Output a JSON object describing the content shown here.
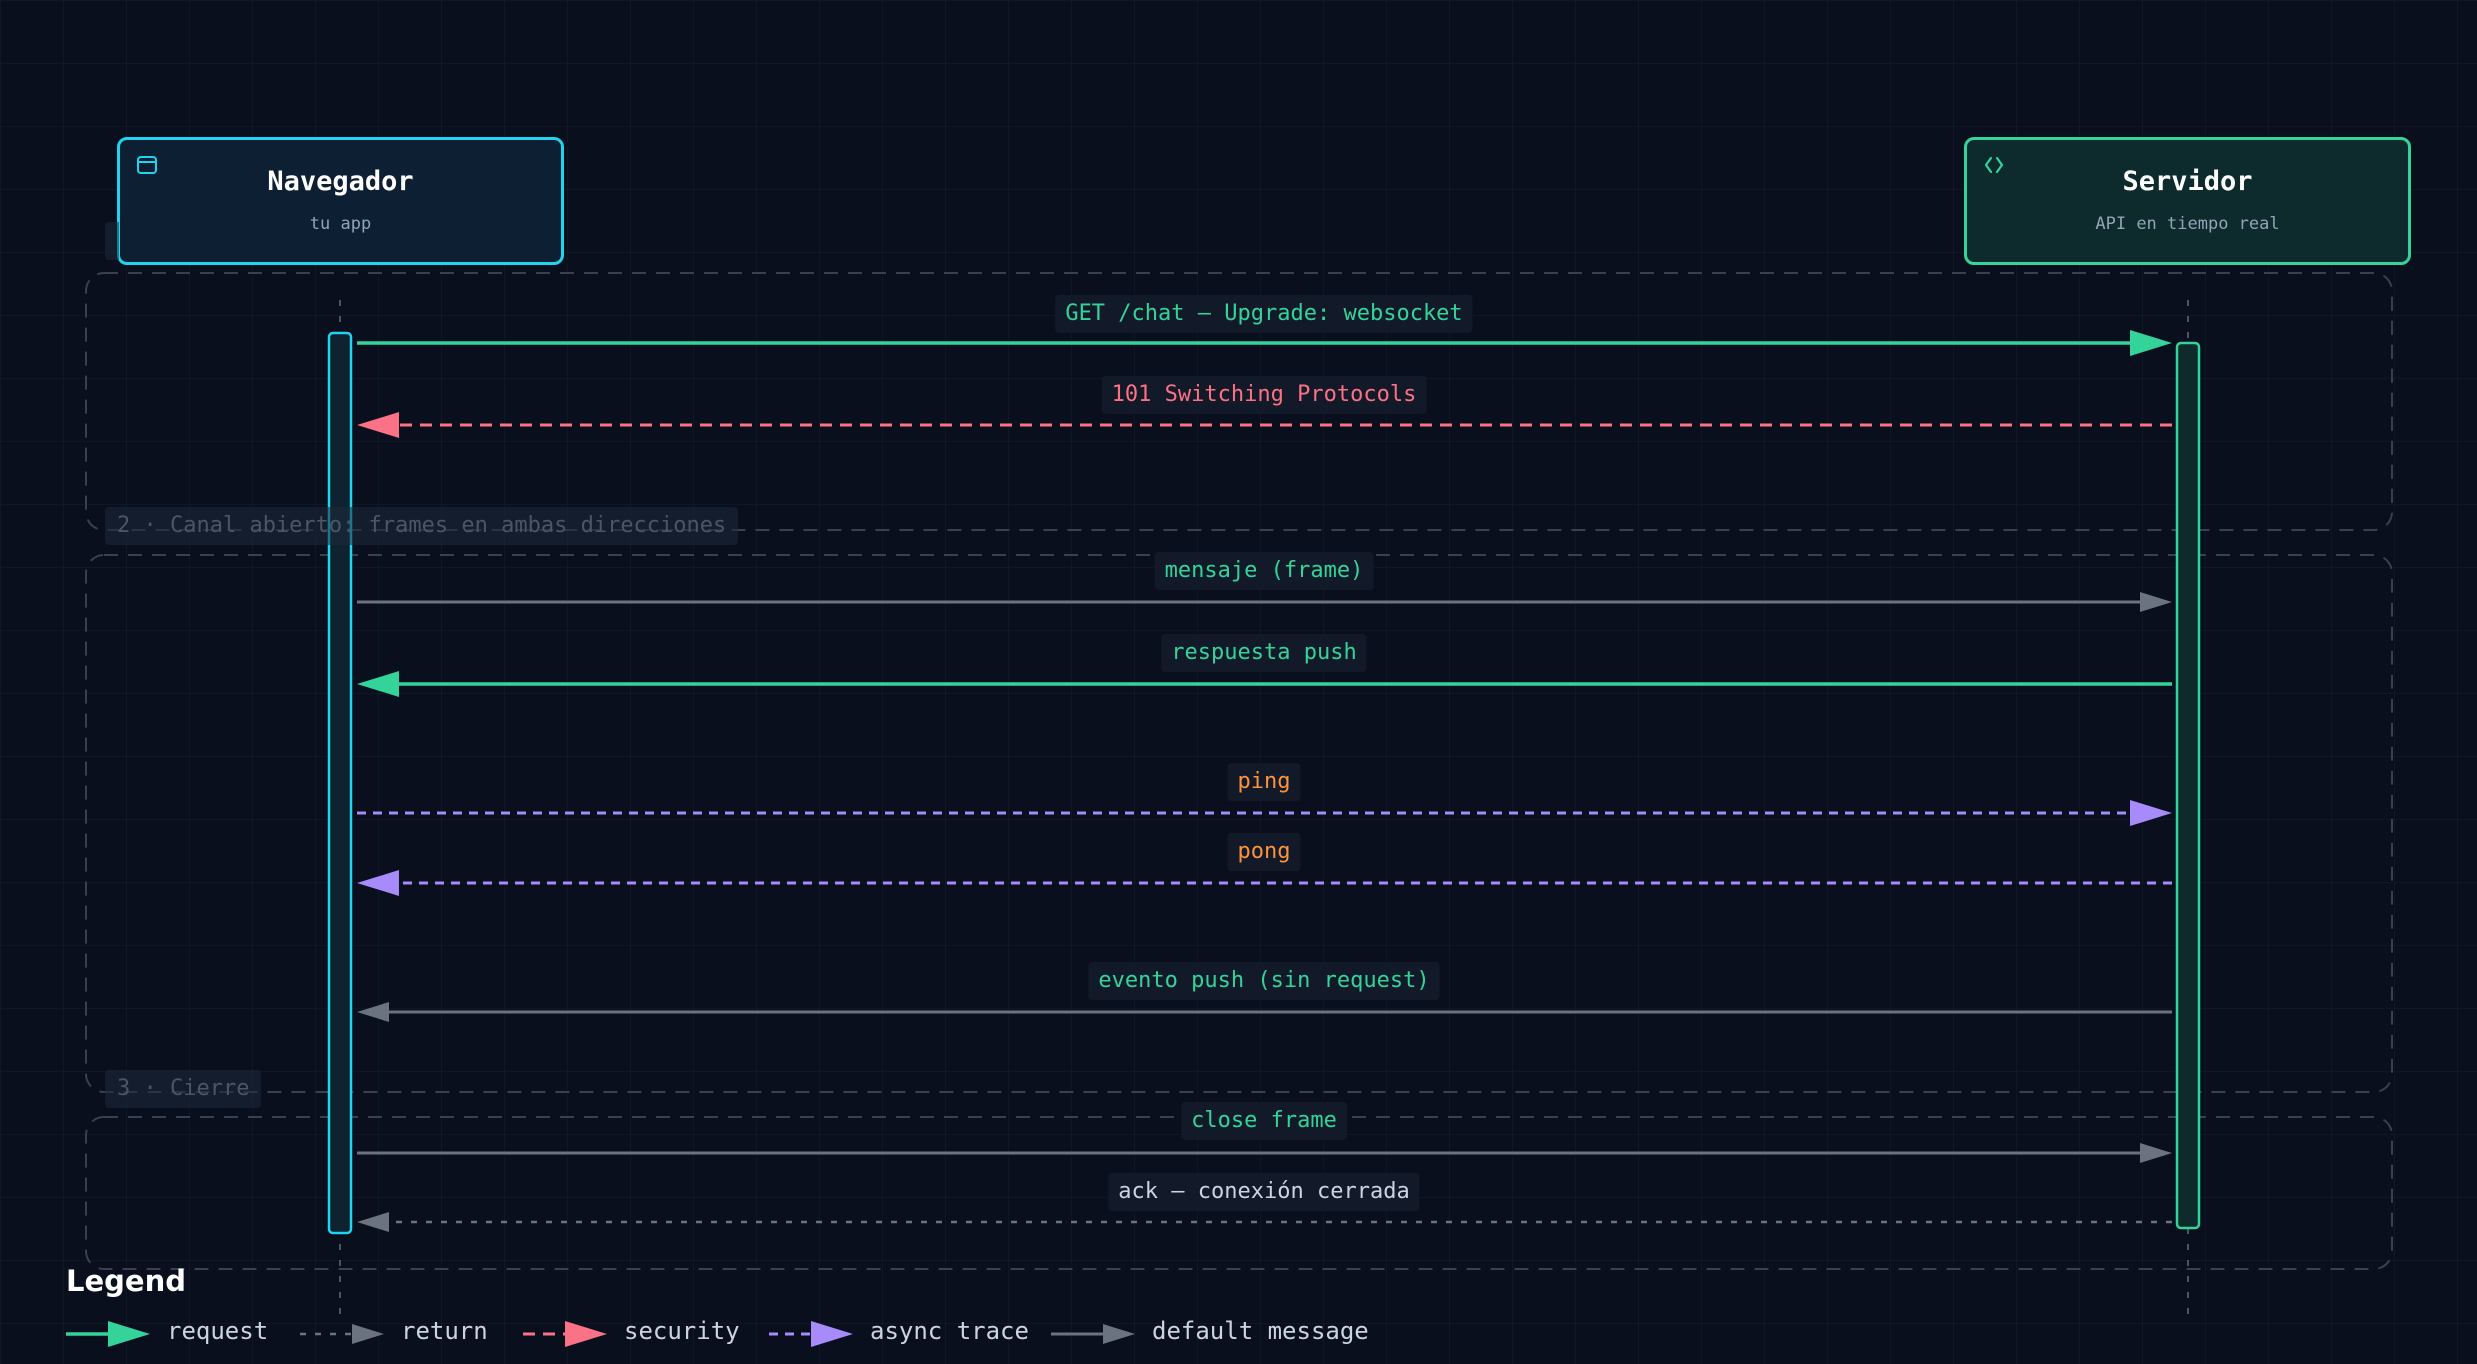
{
  "actors": [
    {
      "name": "Navegador",
      "subtitle": "tu app",
      "icon": "browser-window-icon",
      "color": "#22d3ee"
    },
    {
      "name": "Servidor",
      "subtitle": "API en tiempo real",
      "icon": "code-brackets-icon",
      "color": "#34d399"
    }
  ],
  "frames": [
    {
      "label": ""
    },
    {
      "label": "2 · Canal abierto: frames en ambas direcciones"
    },
    {
      "label": "3 · Cierre"
    }
  ],
  "messages": [
    {
      "label": "GET /chat — Upgrade: websocket",
      "from": "Navegador",
      "to": "Servidor",
      "type": "request",
      "label_color": "#34d399"
    },
    {
      "label": "101 Switching Protocols",
      "from": "Servidor",
      "to": "Navegador",
      "type": "security",
      "label_color": "#fb7185"
    },
    {
      "label": "mensaje (frame)",
      "from": "Navegador",
      "to": "Servidor",
      "type": "default",
      "label_color": "#34d399"
    },
    {
      "label": "respuesta push",
      "from": "Servidor",
      "to": "Navegador",
      "type": "request",
      "label_color": "#34d399"
    },
    {
      "label": "ping",
      "from": "Navegador",
      "to": "Servidor",
      "type": "async",
      "label_color": "#fb923c"
    },
    {
      "label": "pong",
      "from": "Servidor",
      "to": "Navegador",
      "type": "async",
      "label_color": "#fb923c"
    },
    {
      "label": "evento push (sin request)",
      "from": "Servidor",
      "to": "Navegador",
      "type": "default",
      "label_color": "#34d399"
    },
    {
      "label": "close frame",
      "from": "Navegador",
      "to": "Servidor",
      "type": "default",
      "label_color": "#34d399"
    },
    {
      "label": "ack — conexión cerrada",
      "from": "Servidor",
      "to": "Navegador",
      "type": "return",
      "label_color": "#cbd5e1"
    }
  ],
  "legend": {
    "title": "Legend",
    "items": [
      {
        "label": "request",
        "type": "request"
      },
      {
        "label": "return",
        "type": "return"
      },
      {
        "label": "security",
        "type": "security"
      },
      {
        "label": "async trace",
        "type": "async"
      },
      {
        "label": "default message",
        "type": "default"
      }
    ]
  },
  "colors": {
    "background": "#0a0f1e",
    "request": "#34d399",
    "return": "#6b7280",
    "security": "#fb7185",
    "async": "#a78bfa",
    "default": "#6b7280",
    "frame_border": "#374151"
  }
}
